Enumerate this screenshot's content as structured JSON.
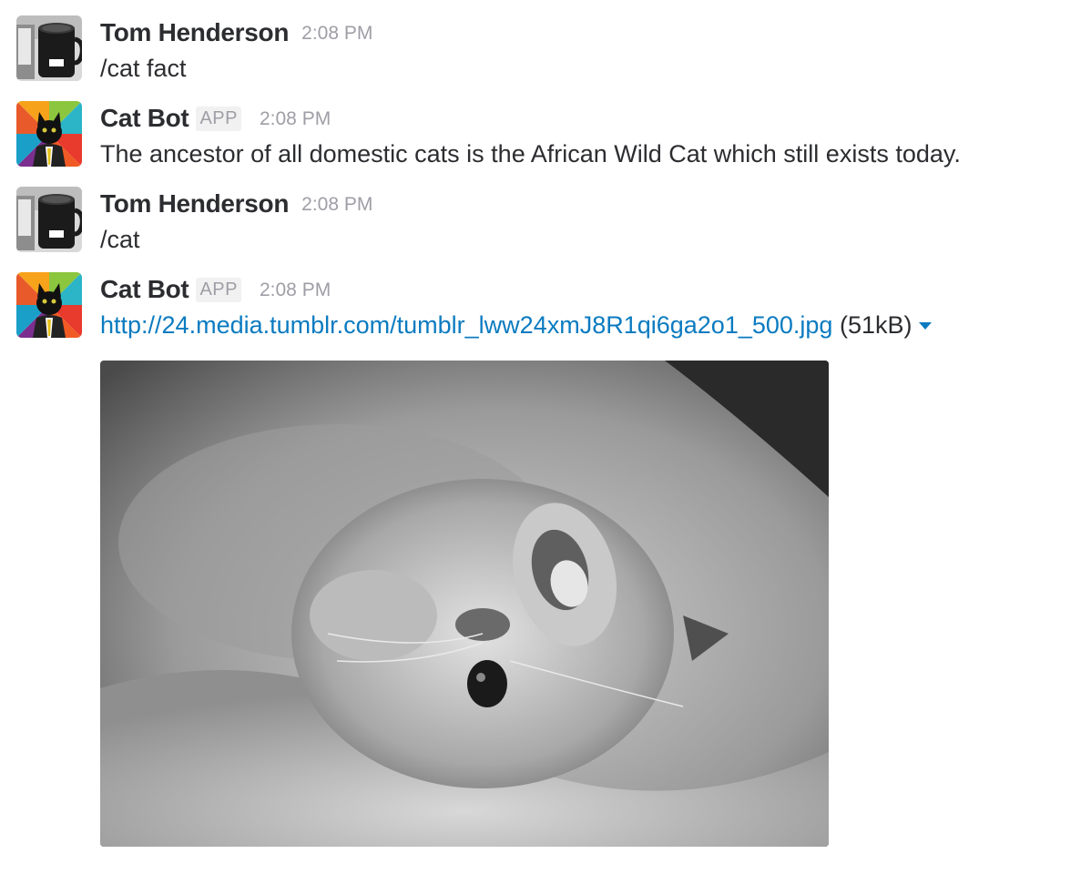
{
  "messages": [
    {
      "author": "Tom Henderson",
      "time": "2:08 PM",
      "text": "/cat fact",
      "avatar_icon": "coffee-mug-avatar"
    },
    {
      "author": "Cat Bot",
      "badge": "APP",
      "time": "2:08 PM",
      "text": "The ancestor of all domestic cats is the African Wild Cat which still exists today.",
      "avatar_icon": "business-cat-avatar"
    },
    {
      "author": "Tom Henderson",
      "time": "2:08 PM",
      "text": "/cat",
      "avatar_icon": "coffee-mug-avatar"
    },
    {
      "author": "Cat Bot",
      "badge": "APP",
      "time": "2:08 PM",
      "link": "http://24.media.tumblr.com/tumblr_lww24xmJ8R1qi6ga2o1_500.jpg",
      "file_size": "(51kB)",
      "avatar_icon": "business-cat-avatar",
      "attachment": "kitten-photo"
    }
  ],
  "colors": {
    "link": "#0b7bc0",
    "muted": "#9e9ea6",
    "text": "#2c2d30"
  }
}
